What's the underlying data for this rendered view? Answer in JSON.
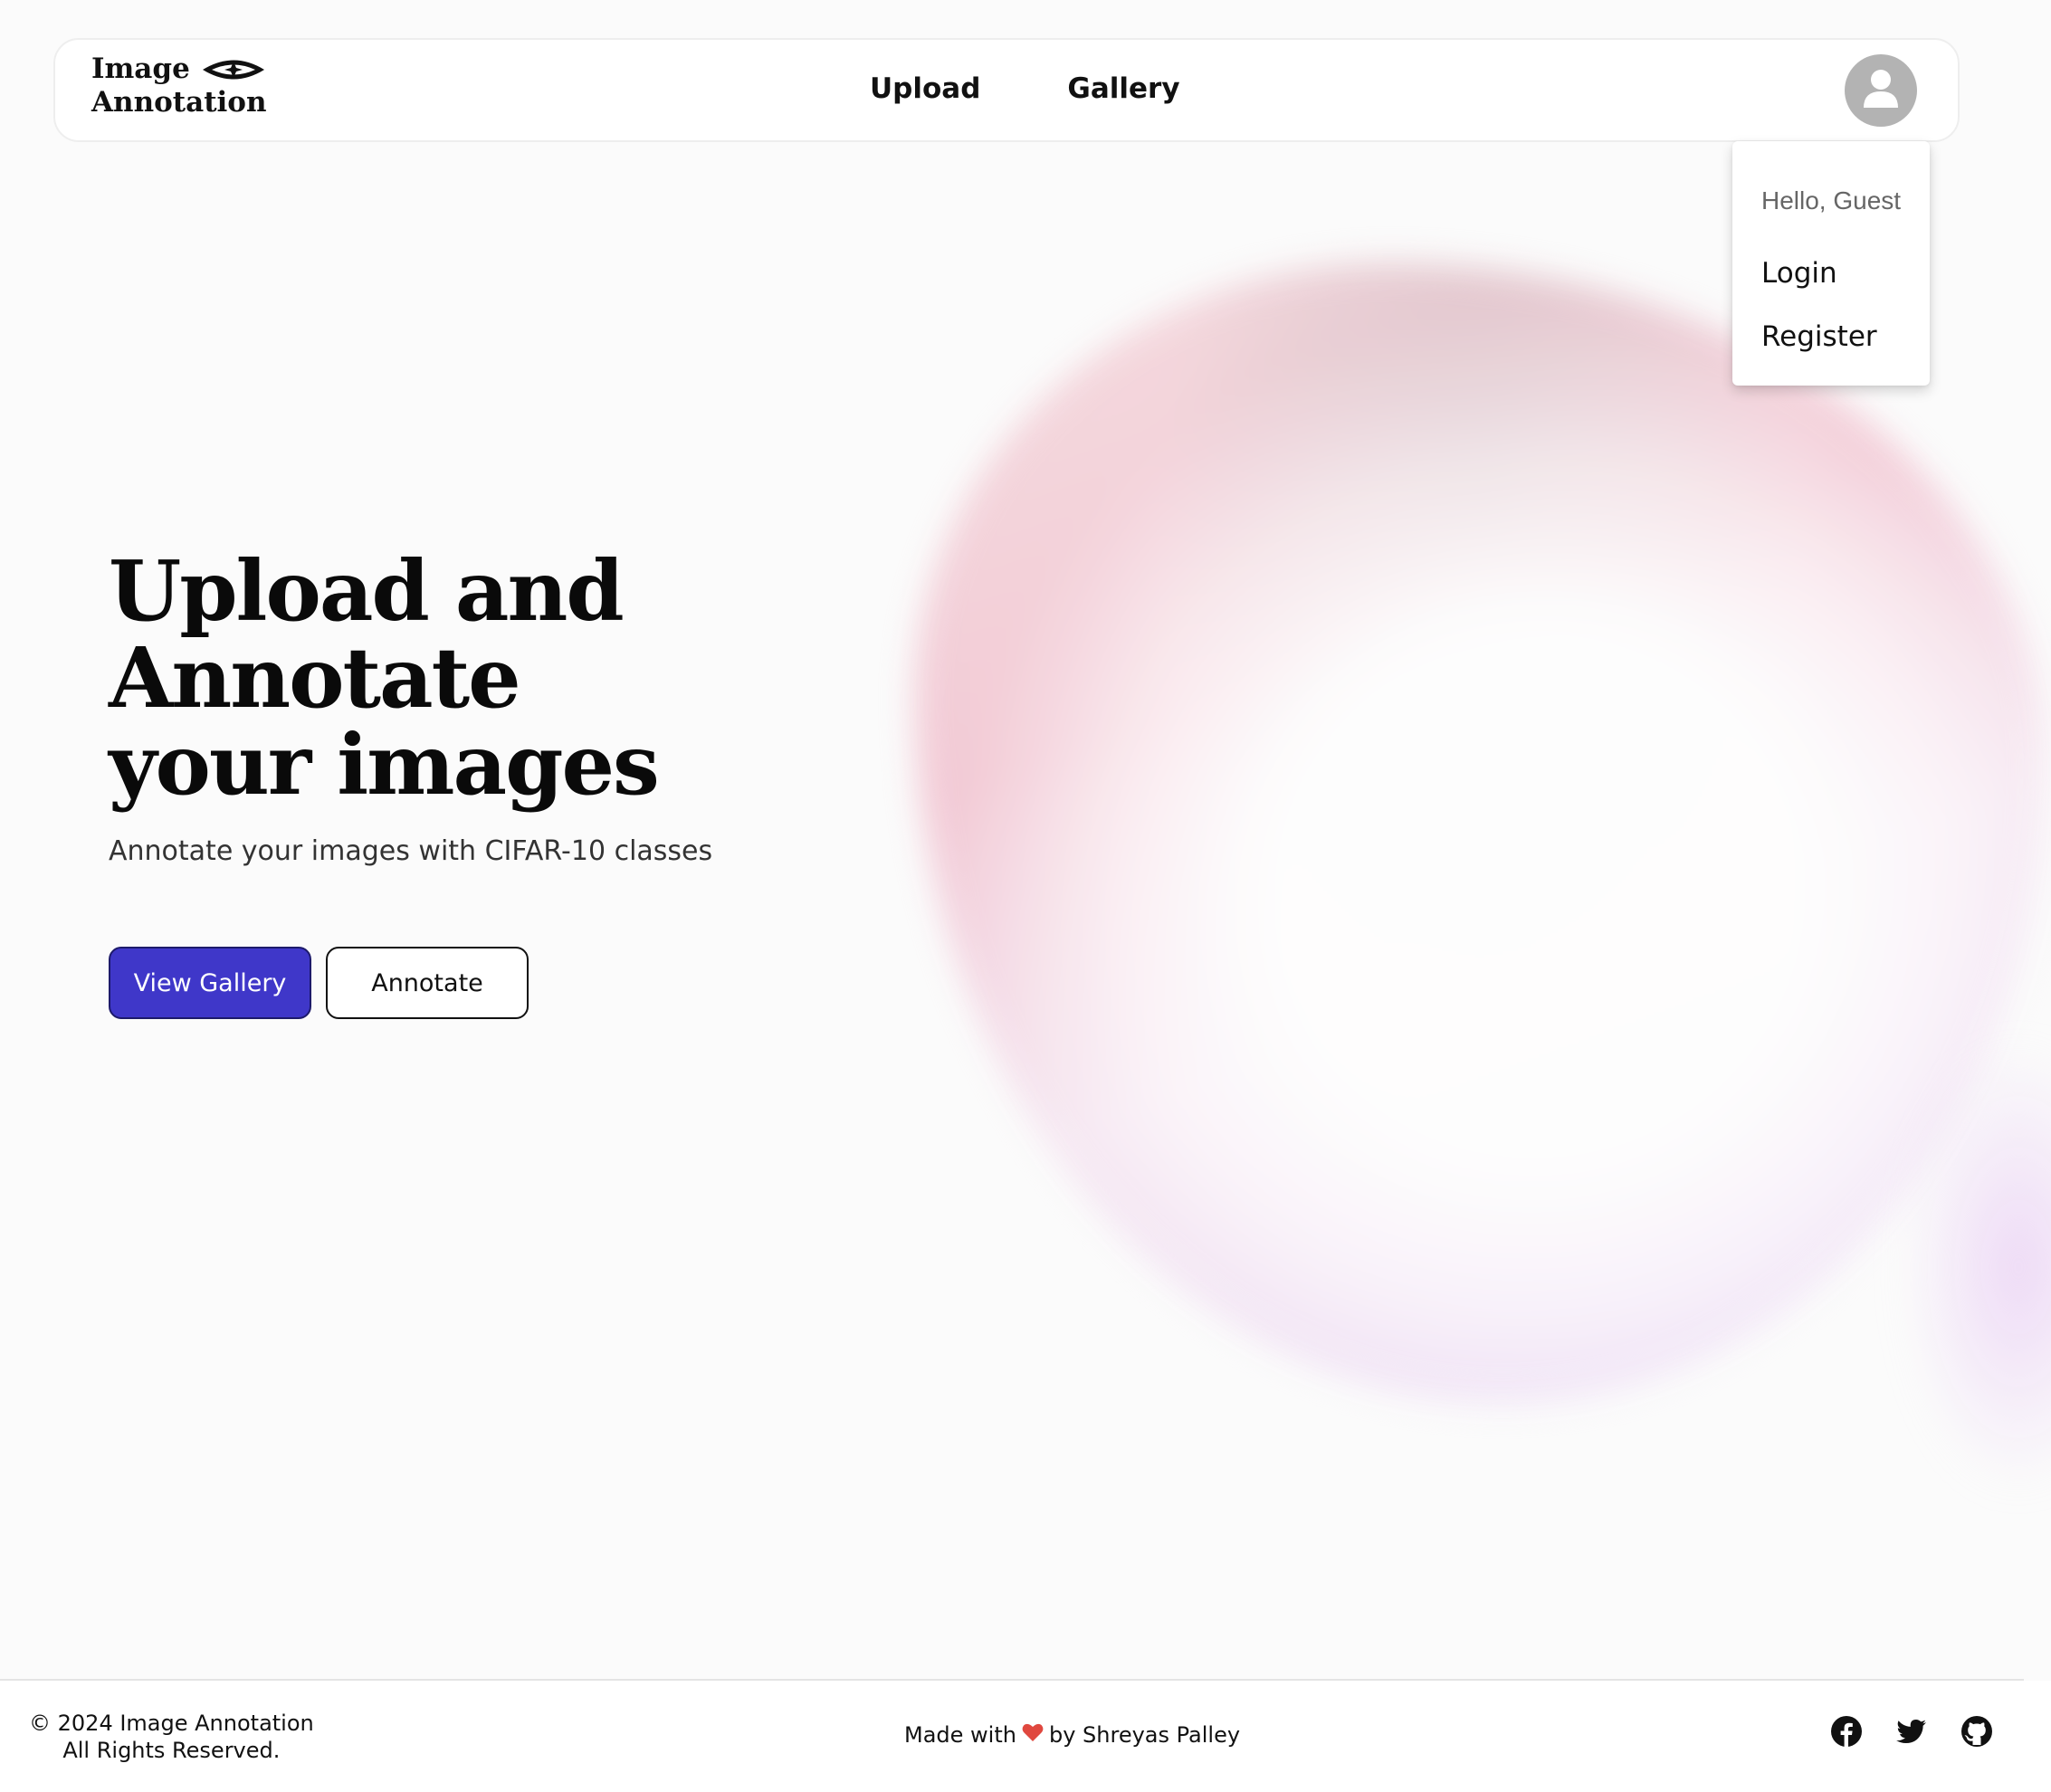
{
  "navbar": {
    "logo_line1": "Image",
    "logo_line2": "Annotation",
    "links": [
      "Upload",
      "Gallery"
    ]
  },
  "user_menu": {
    "greeting": "Hello, Guest",
    "items": [
      "Login",
      "Register"
    ]
  },
  "hero": {
    "title": "Upload and Annotate your images",
    "subtitle": "Annotate your images with CIFAR-10 classes",
    "primary_button": "View Gallery",
    "secondary_button": "Annotate"
  },
  "footer": {
    "copyright_line1": "© 2024 Image Annotation",
    "copyright_line2": "All Rights Reserved.",
    "made_prefix": "Made with",
    "made_suffix": "by Shreyas Palley",
    "social_icons": [
      "facebook-icon",
      "twitter-icon",
      "github-icon"
    ]
  },
  "colors": {
    "accent": "#3f37c9",
    "avatar": "#b3b3b3",
    "heart": "#e0483f"
  }
}
